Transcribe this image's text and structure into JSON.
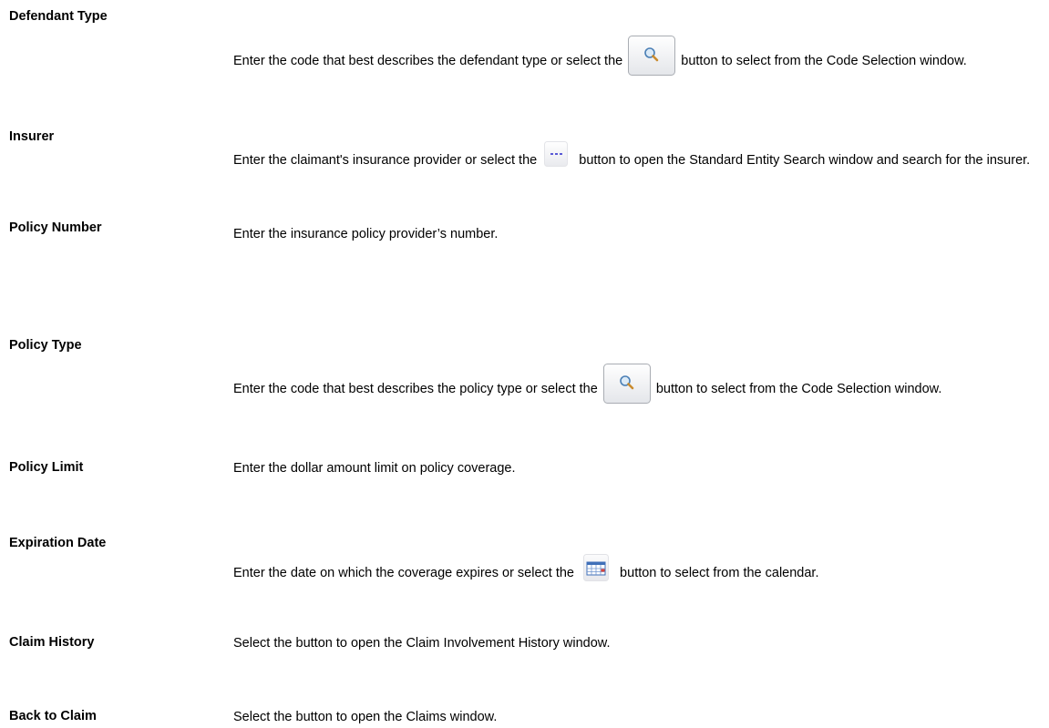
{
  "rows": [
    {
      "term": "Defendant Type",
      "desc_before": "Enter the code that best describes the defendant type or select the ",
      "icon": "search-button-icon",
      "desc_after": " button to select from the Code Selection window."
    },
    {
      "term": "Insurer",
      "desc_before": "Enter the claimant's insurance provider or select the ",
      "icon": "ellipsis-button-icon",
      "desc_after": " button to open the Standard Entity Search window and search for the insurer."
    },
    {
      "term": "Policy Number",
      "desc": "Enter the insurance policy provider’s number."
    },
    {
      "term": "Policy Type",
      "desc_before": "Enter the code that best describes the policy type or select the ",
      "icon": "search-button-icon",
      "desc_after": " button to select from the Code Selection window."
    },
    {
      "term": "Policy Limit",
      "desc": "Enter the dollar amount limit on policy coverage."
    },
    {
      "term": "Expiration Date",
      "desc_before": "Enter the date on which the coverage expires or select the ",
      "icon": "calendar-button-icon",
      "desc_after": " button to select from the calendar."
    },
    {
      "term": "Claim History",
      "desc": "Select the button to open the Claim Involvement History window."
    },
    {
      "term": "Back to Claim",
      "desc": "Select the button to open the Claims window."
    }
  ]
}
